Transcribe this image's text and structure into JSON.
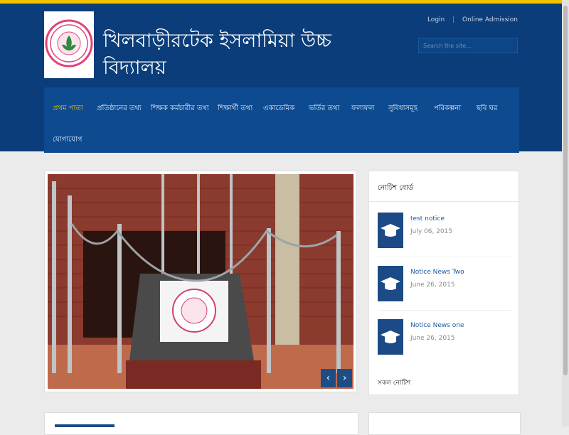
{
  "header": {
    "school_name": "খিলবাড়ীরটেক ইসলামিয়া উচ্চ বিদ্যালয়",
    "login": "Login",
    "online_admission": "Online Admission",
    "search_placeholder": "Search the site..."
  },
  "nav": {
    "items": [
      "প্রথম পাতা",
      "প্রতিষ্ঠানের তথ্য",
      "শিক্ষক কর্মচারীর তথ্য",
      "শিক্ষার্থী তথ্য",
      "একাডেমিক",
      "ভর্তির তথ্য",
      "ফলাফল",
      "সুবিধাসমূহ",
      "পরিকল্পনা",
      "ছবি ঘর",
      "যোগাযোগ"
    ]
  },
  "slider": {
    "prev": "‹",
    "next": "›"
  },
  "notice_board": {
    "title": "নোটিশ বোর্ড",
    "items": [
      {
        "title": "test notice",
        "date": "July 06, 2015"
      },
      {
        "title": "Notice News Two",
        "date": "June 26, 2015"
      },
      {
        "title": "Notice News one",
        "date": "June 26, 2015"
      }
    ],
    "all_notices": "সকল নোটিশ"
  },
  "colors": {
    "header_bg": "#0b3d7a",
    "nav_bg": "#0d4a90",
    "active": "#f2c200",
    "icon_bg": "#1b4a86"
  }
}
